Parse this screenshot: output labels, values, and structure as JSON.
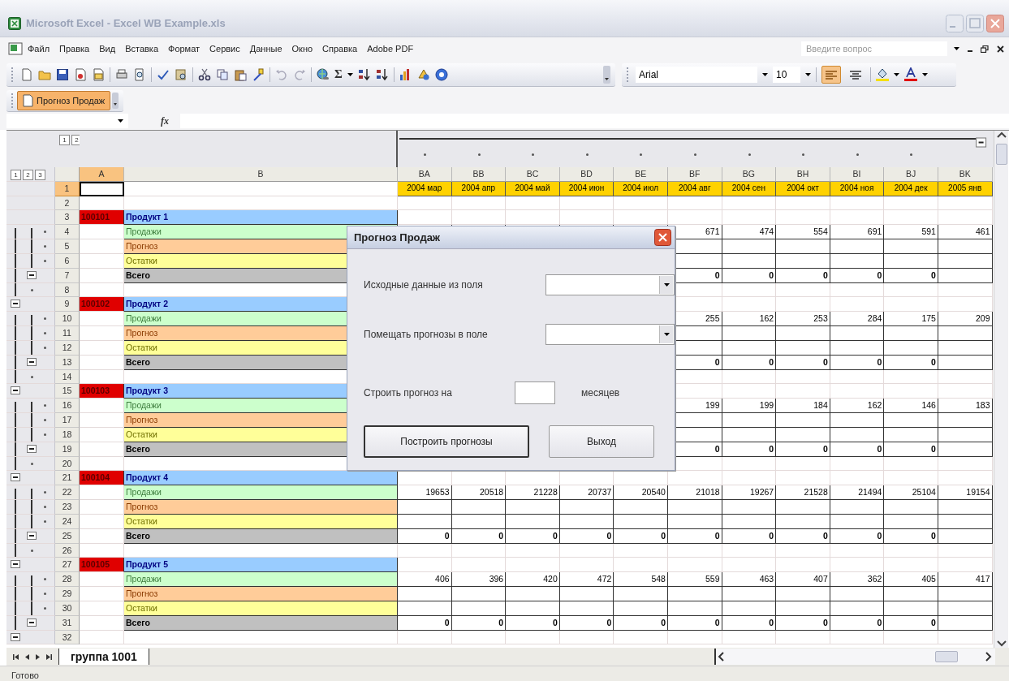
{
  "window": {
    "title": "Microsoft Excel - Excel WB Example.xls"
  },
  "menu": [
    "Файл",
    "Правка",
    "Вид",
    "Вставка",
    "Формат",
    "Сервис",
    "Данные",
    "Окно",
    "Справка",
    "Adobe PDF"
  ],
  "help_search": {
    "placeholder": "Введите вопрос"
  },
  "toolbar": {
    "autosum": "Σ",
    "font": "Arial",
    "size": "10",
    "alignment": [
      {
        "kind": "left",
        "selected": true
      },
      {
        "kind": "center",
        "selected": false
      }
    ]
  },
  "custom_toolbar": {
    "button": "Прогноз Продаж",
    "active": true
  },
  "formula_bar": {
    "function_label": "fx"
  },
  "sheet": {
    "row_levels": [
      "1",
      "2",
      "3"
    ],
    "column_levels": [
      "1",
      "2"
    ],
    "columns": [
      {
        "name": "A",
        "selected": true
      },
      {
        "name": "B",
        "selected": false
      },
      {
        "name": "BA",
        "selected": false
      },
      {
        "name": "BB",
        "selected": false
      },
      {
        "name": "BC",
        "selected": false
      },
      {
        "name": "BD",
        "selected": false
      },
      {
        "name": "BE",
        "selected": false
      },
      {
        "name": "BF",
        "selected": false
      },
      {
        "name": "BG",
        "selected": false
      },
      {
        "name": "BH",
        "selected": false
      },
      {
        "name": "BI",
        "selected": false
      },
      {
        "name": "BJ",
        "selected": false
      },
      {
        "name": "BK",
        "selected": false
      }
    ],
    "rows": [
      {
        "number": "1",
        "selected": true,
        "kind": "dates",
        "cells": {
          "BA": "2004 мар",
          "BB": "2004 апр",
          "BC": "2004 май",
          "BD": "2004 июн",
          "BE": "2004 июл",
          "BF": "2004 авг",
          "BG": "2004 сен",
          "BH": "2004 окт",
          "BI": "2004 ноя",
          "BJ": "2004 дек",
          "BK": "2005 янв"
        }
      },
      {
        "number": "2",
        "selected": false,
        "kind": "blank"
      },
      {
        "number": "3",
        "selected": false,
        "kind": "product",
        "code": "100101",
        "name": "Продукт 1"
      },
      {
        "number": "4",
        "selected": false,
        "kind": "sales",
        "outline": {
          "kind": "dot-inner"
        },
        "name": "Продажи",
        "cells": {
          "BF": "671",
          "BG": "474",
          "BH": "554",
          "BI": "691",
          "BJ": "591",
          "BK": "461"
        }
      },
      {
        "number": "5",
        "selected": false,
        "kind": "forecast",
        "outline": {
          "kind": "dot-inner"
        },
        "name": "Прогноз"
      },
      {
        "number": "6",
        "selected": false,
        "kind": "stock",
        "outline": {
          "kind": "dot-inner"
        },
        "name": "Остатки"
      },
      {
        "number": "7",
        "selected": false,
        "kind": "total",
        "outline": {
          "kind": "minus-inner"
        },
        "name": "Всего",
        "cells": {
          "BF": "0",
          "BG": "0",
          "BH": "0",
          "BI": "0",
          "BJ": "0"
        }
      },
      {
        "number": "8",
        "selected": false,
        "kind": "blank",
        "outline": {
          "kind": "dot-outer"
        }
      },
      {
        "number": "9",
        "selected": false,
        "kind": "product",
        "outline": {
          "kind": "minus-outer"
        },
        "code": "100102",
        "name": "Продукт 2"
      },
      {
        "number": "10",
        "selected": false,
        "kind": "sales",
        "outline": {
          "kind": "dot-inner"
        },
        "name": "Продажи",
        "cells": {
          "BF": "255",
          "BG": "162",
          "BH": "253",
          "BI": "284",
          "BJ": "175",
          "BK": "209"
        }
      },
      {
        "number": "11",
        "selected": false,
        "kind": "forecast",
        "outline": {
          "kind": "dot-inner"
        },
        "name": "Прогноз"
      },
      {
        "number": "12",
        "selected": false,
        "kind": "stock",
        "outline": {
          "kind": "dot-inner"
        },
        "name": "Остатки"
      },
      {
        "number": "13",
        "selected": false,
        "kind": "total",
        "outline": {
          "kind": "minus-inner"
        },
        "name": "Всего",
        "cells": {
          "BF": "0",
          "BG": "0",
          "BH": "0",
          "BI": "0",
          "BJ": "0"
        }
      },
      {
        "number": "14",
        "selected": false,
        "kind": "blank",
        "outline": {
          "kind": "dot-outer"
        }
      },
      {
        "number": "15",
        "selected": false,
        "kind": "product",
        "outline": {
          "kind": "minus-outer"
        },
        "code": "100103",
        "name": "Продукт 3"
      },
      {
        "number": "16",
        "selected": false,
        "kind": "sales",
        "outline": {
          "kind": "dot-inner"
        },
        "name": "Продажи",
        "cells": {
          "BF": "199",
          "BG": "199",
          "BH": "184",
          "BI": "162",
          "BJ": "146",
          "BK": "183"
        }
      },
      {
        "number": "17",
        "selected": false,
        "kind": "forecast",
        "outline": {
          "kind": "dot-inner"
        },
        "name": "Прогноз"
      },
      {
        "number": "18",
        "selected": false,
        "kind": "stock",
        "outline": {
          "kind": "dot-inner"
        },
        "name": "Остатки"
      },
      {
        "number": "19",
        "selected": false,
        "kind": "total",
        "outline": {
          "kind": "minus-inner"
        },
        "name": "Всего",
        "cells": {
          "BF": "0",
          "BG": "0",
          "BH": "0",
          "BI": "0",
          "BJ": "0"
        }
      },
      {
        "number": "20",
        "selected": false,
        "kind": "blank",
        "outline": {
          "kind": "dot-outer"
        }
      },
      {
        "number": "21",
        "selected": false,
        "kind": "product",
        "outline": {
          "kind": "minus-outer"
        },
        "code": "100104",
        "name": "Продукт 4"
      },
      {
        "number": "22",
        "selected": false,
        "kind": "sales",
        "outline": {
          "kind": "dot-inner"
        },
        "name": "Продажи",
        "cells": {
          "BA": "19653",
          "BB": "20518",
          "BC": "21228",
          "BD": "20737",
          "BE": "20540",
          "BF": "21018",
          "BG": "19267",
          "BH": "21528",
          "BI": "21494",
          "BJ": "25104",
          "BK": "19154"
        }
      },
      {
        "number": "23",
        "selected": false,
        "kind": "forecast",
        "outline": {
          "kind": "dot-inner"
        },
        "name": "Прогноз"
      },
      {
        "number": "24",
        "selected": false,
        "kind": "stock",
        "outline": {
          "kind": "dot-inner"
        },
        "name": "Остатки"
      },
      {
        "number": "25",
        "selected": false,
        "kind": "total",
        "outline": {
          "kind": "minus-inner"
        },
        "name": "Всего",
        "cells": {
          "BA": "0",
          "BB": "0",
          "BC": "0",
          "BD": "0",
          "BE": "0",
          "BF": "0",
          "BG": "0",
          "BH": "0",
          "BI": "0",
          "BJ": "0"
        }
      },
      {
        "number": "26",
        "selected": false,
        "kind": "blank",
        "outline": {
          "kind": "dot-outer"
        }
      },
      {
        "number": "27",
        "selected": false,
        "kind": "product",
        "outline": {
          "kind": "minus-outer"
        },
        "code": "100105",
        "name": "Продукт 5"
      },
      {
        "number": "28",
        "selected": false,
        "kind": "sales",
        "outline": {
          "kind": "dot-inner"
        },
        "name": "Продажи",
        "cells": {
          "BA": "406",
          "BB": "396",
          "BC": "420",
          "BD": "472",
          "BE": "548",
          "BF": "559",
          "BG": "463",
          "BH": "407",
          "BI": "362",
          "BJ": "405",
          "BK": "417"
        }
      },
      {
        "number": "29",
        "selected": false,
        "kind": "forecast",
        "outline": {
          "kind": "dot-inner"
        },
        "name": "Прогноз"
      },
      {
        "number": "30",
        "selected": false,
        "kind": "stock",
        "outline": {
          "kind": "dot-inner"
        },
        "name": "Остатки"
      },
      {
        "number": "31",
        "selected": false,
        "kind": "total",
        "outline": {
          "kind": "minus-inner"
        },
        "name": "Всего",
        "cells": {
          "BA": "0",
          "BB": "0",
          "BC": "0",
          "BD": "0",
          "BE": "0",
          "BF": "0",
          "BG": "0",
          "BH": "0",
          "BI": "0",
          "BJ": "0"
        }
      },
      {
        "number": "32",
        "selected": false,
        "kind": "blank",
        "outline": {
          "kind": "minus-outer"
        }
      }
    ]
  },
  "dialog": {
    "title": "Прогноз Продаж",
    "source_label": "Исходные данные из поля",
    "target_label": "Помещать прогнозы в поле",
    "horizon_label": "Строить прогноз на",
    "horizon_unit": "месяцев",
    "buttons": [
      {
        "label": "Построить прогнозы",
        "default": true
      },
      {
        "label": "Выход",
        "default": false
      }
    ]
  },
  "sheet_tabs": [
    {
      "label": "группа 1001",
      "selected": true
    }
  ],
  "status_bar": "Готово"
}
